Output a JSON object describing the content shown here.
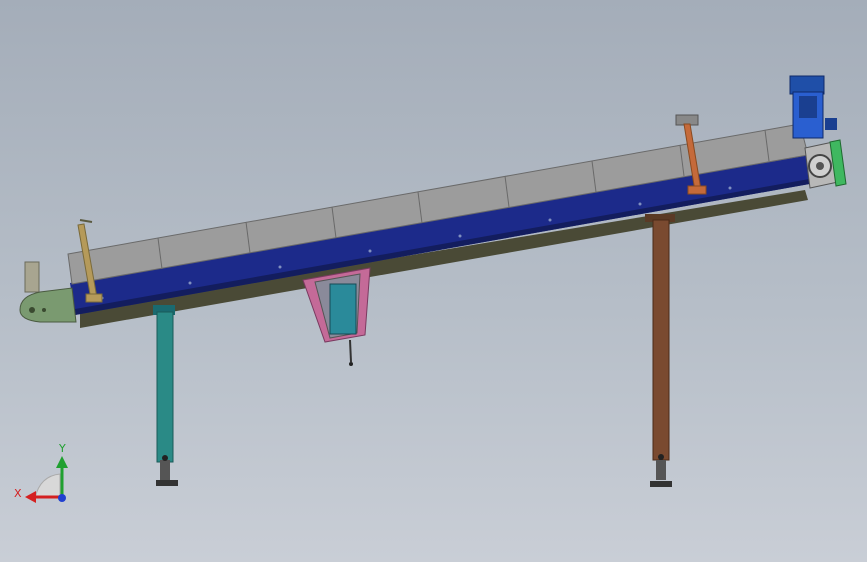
{
  "window": {
    "type": "cad-3d-viewport"
  },
  "model": {
    "name": "inclined-belt-conveyor",
    "colors": {
      "cover": "#9c9c9c",
      "cover_edge": "#6a6a6a",
      "frame": "#1c2a8a",
      "frame_dark": "#131d5e",
      "underside": "#4a4a36",
      "leg_left": "#2a8a86",
      "leg_right": "#7a4a30",
      "bracket_left": "#b59a5a",
      "bracket_right": "#c56a3a",
      "hopper_pink": "#c46a98",
      "hopper_cyan": "#2a8a9a",
      "motor": "#2a5fd0",
      "gearbox": "#b8b8b8",
      "end_plate": "#3fb860",
      "drive_end_left": "#7a9a70"
    }
  },
  "triad": {
    "x_label": "X",
    "y_label": "Y",
    "x_color": "#d42020",
    "y_color": "#20a030",
    "z_color": "#2040d0"
  }
}
